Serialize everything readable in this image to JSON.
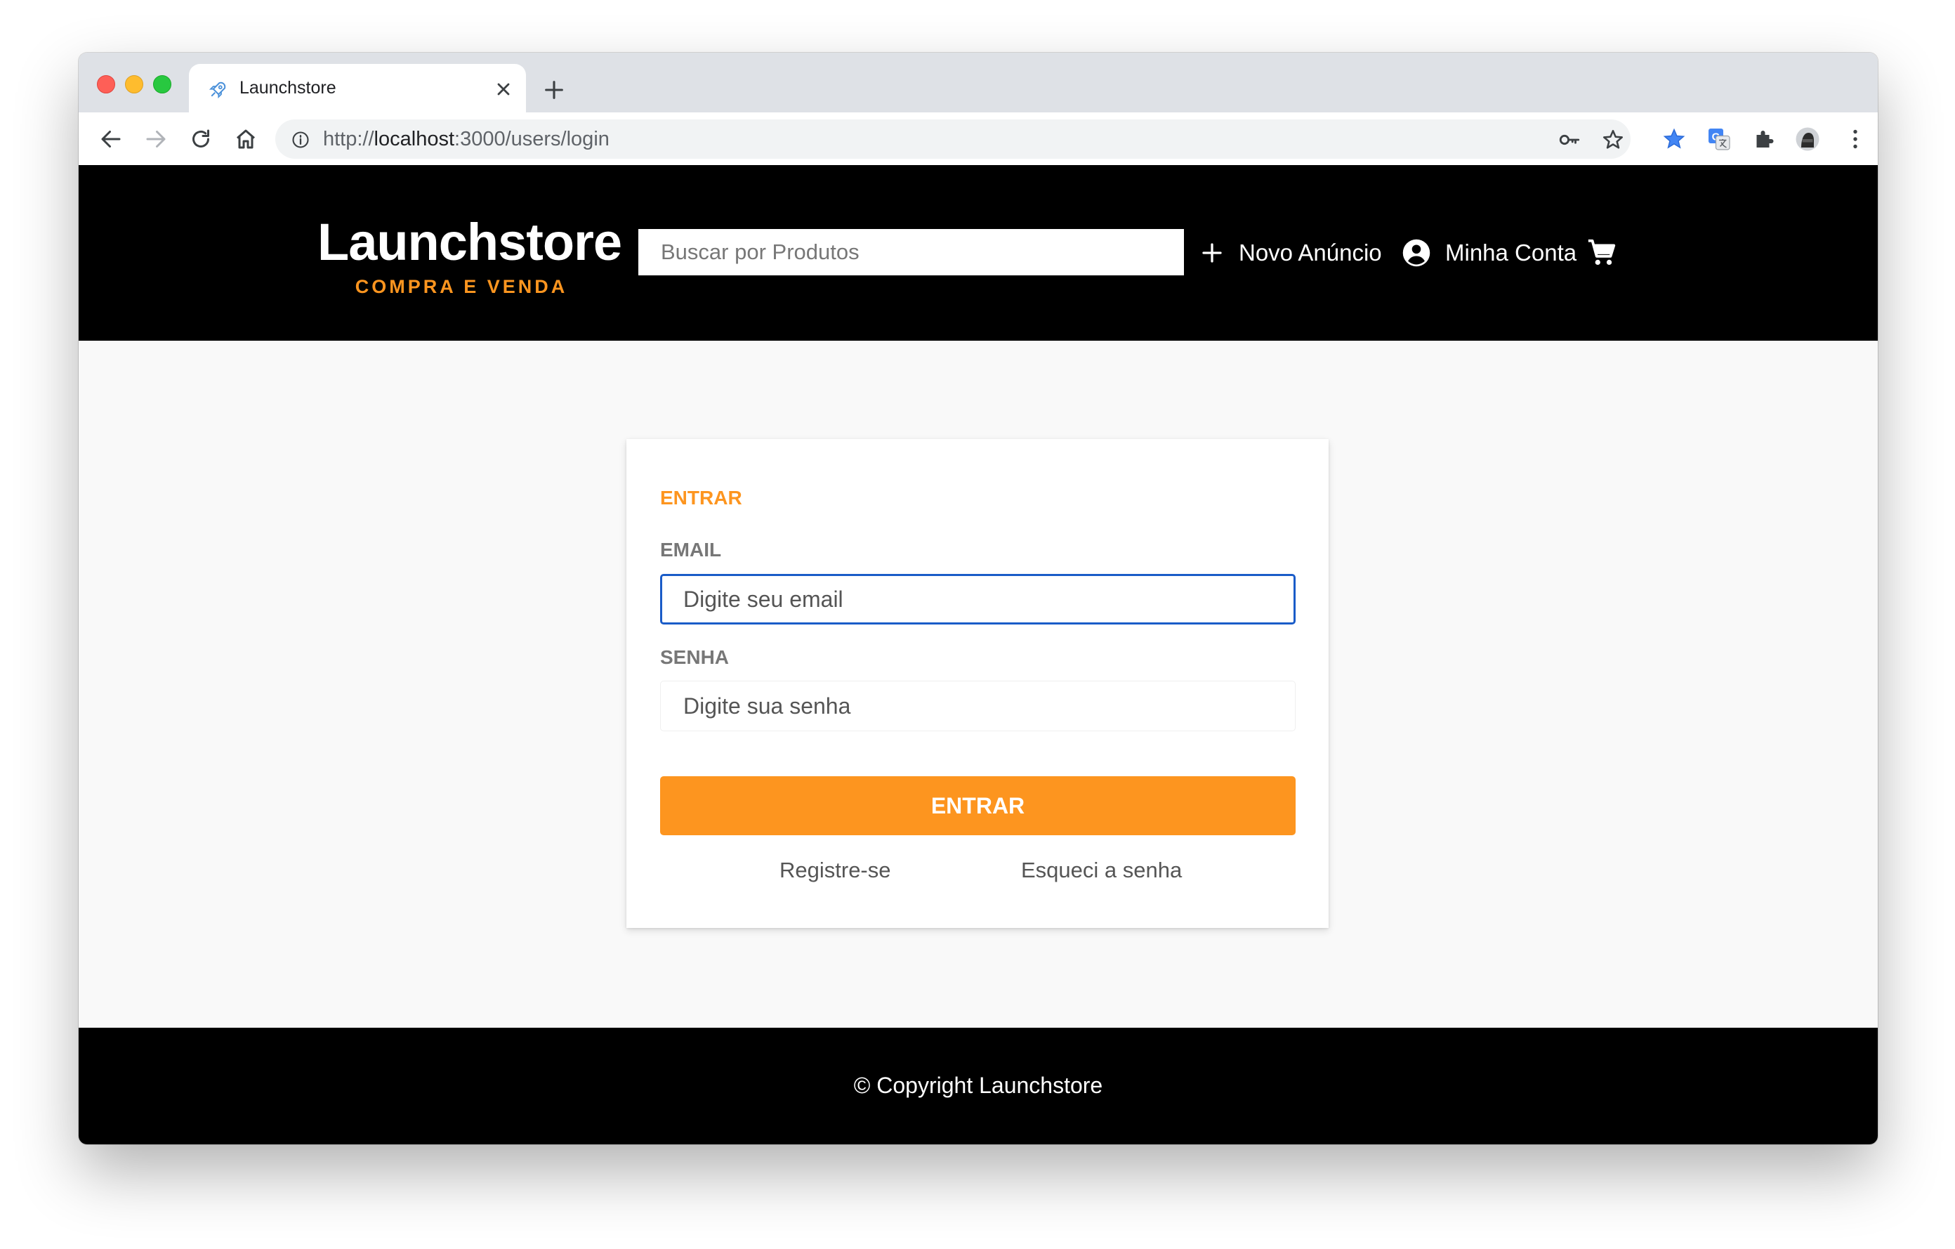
{
  "browser": {
    "tab": {
      "title": "Launchstore",
      "favicon": "rocket-icon"
    },
    "address": {
      "scheme": "http://",
      "host": "localhost",
      "rest": ":3000/users/login"
    }
  },
  "header": {
    "logo_title": "Launchstore",
    "logo_subtitle": "COMPRA E VENDA",
    "search_placeholder": "Buscar por Produtos",
    "nav": [
      {
        "label": "Novo Anúncio",
        "icon": "plus-icon"
      },
      {
        "label": "Minha Conta",
        "icon": "account-circle-icon"
      },
      {
        "icon": "cart-icon"
      }
    ]
  },
  "login": {
    "title": "ENTRAR",
    "email_label": "EMAIL",
    "email_placeholder": "Digite seu email",
    "password_label": "SENHA",
    "password_placeholder": "Digite sua senha",
    "submit_label": "ENTRAR",
    "register_link": "Registre-se",
    "forgot_link": "Esqueci a senha"
  },
  "footer": {
    "text": "© Copyright Launchstore"
  },
  "colors": {
    "accent": "#fd951f",
    "header_bg": "#000000",
    "page_bg": "#f9f9f9",
    "focus_border": "#1a5cc8"
  }
}
